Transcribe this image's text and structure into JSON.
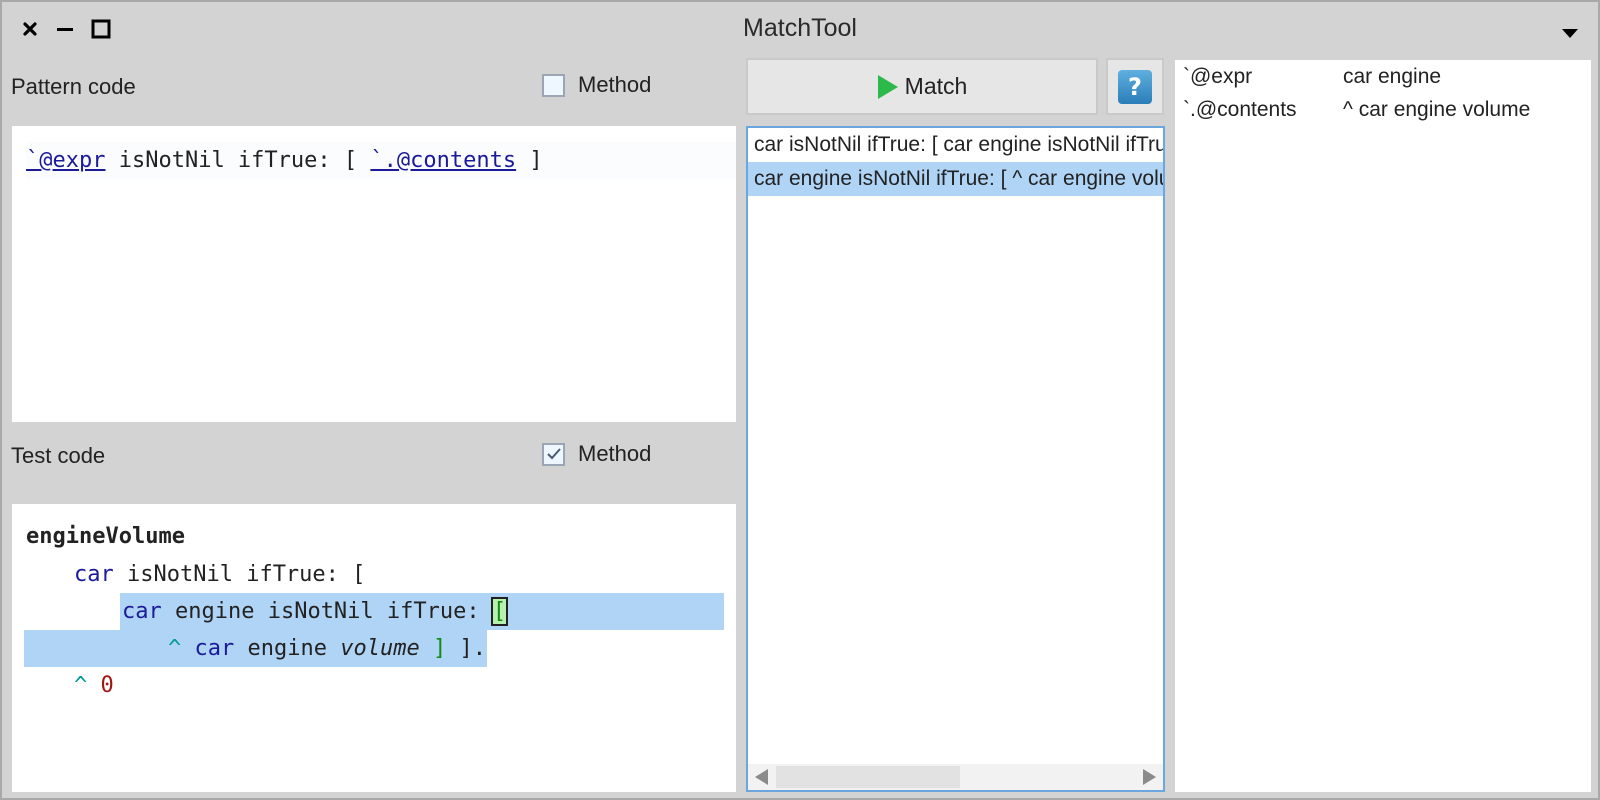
{
  "window": {
    "title": "MatchTool",
    "controls": [
      "close",
      "minimize",
      "maximize"
    ]
  },
  "pattern": {
    "label": "Pattern code",
    "method_checkbox": {
      "label": "Method",
      "checked": false
    },
    "code": {
      "pv1": "`@expr",
      "t1": " isNotNil ifTrue: [ ",
      "pv2": "`.@contents",
      "t2": " ]"
    }
  },
  "test": {
    "label": "Test code",
    "method_checkbox": {
      "label": "Method",
      "checked": true
    },
    "code": {
      "selector": "engineVolume",
      "l2_var": "car",
      "l2_rest": " isNotNil ifTrue: [",
      "l3_var": "car",
      "l3_rest": " engine isNotNil ifTrue: ",
      "l3_bracket": "[",
      "l4_caret": "^",
      "l4_var": "car",
      "l4_mid": " engine ",
      "l4_it": "volume",
      "l4_close": "]",
      "l4_tail": " ].",
      "l5_caret": "^",
      "l5_num": "0"
    }
  },
  "toolbar": {
    "match_label": "Match",
    "help_label": "?"
  },
  "results": {
    "items": [
      {
        "text": "car isNotNil  ifTrue: [ car engine isNotNil  ifTrue: [ ^ car engine volume ] ]",
        "selected": false
      },
      {
        "text": "car engine isNotNil  ifTrue: [ ^ car engine volume ]",
        "selected": true
      }
    ]
  },
  "bindings": [
    {
      "key": "`@expr",
      "value": "car engine"
    },
    {
      "key": "`.@contents",
      "value": "^ car engine volume"
    }
  ],
  "colors": {
    "selection": "#b0d4f6",
    "pattern_var": "#1a1a9a",
    "keyword": "#009a9a",
    "number": "#a31515",
    "play_green": "#2db84a",
    "list_border": "#6ba7de"
  }
}
